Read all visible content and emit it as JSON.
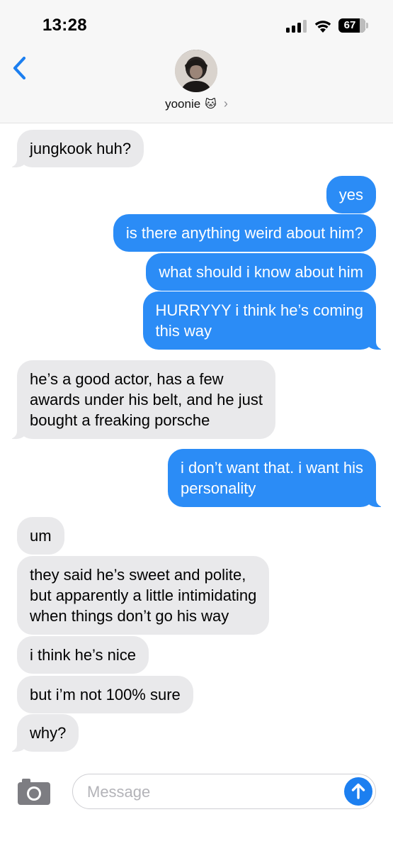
{
  "status_bar": {
    "time": "13:28",
    "battery": "67"
  },
  "header": {
    "contact_name": "yoonie",
    "contact_emoji": "🐱",
    "chevron": "›"
  },
  "messages": [
    {
      "from": "them",
      "text": "jungkook huh?"
    },
    {
      "from": "me",
      "text": "yes"
    },
    {
      "from": "me",
      "text": "is there anything weird about him?"
    },
    {
      "from": "me",
      "text": "what should i know about him"
    },
    {
      "from": "me",
      "text": "HURRYYY i think he’s coming\nthis way"
    },
    {
      "from": "them",
      "text": "he’s a good actor, has a few\nawards under his belt, and he just\nbought a freaking porsche"
    },
    {
      "from": "me",
      "text": "i don’t want that. i want his\npersonality"
    },
    {
      "from": "them",
      "text": "um"
    },
    {
      "from": "them",
      "text": "they said he’s sweet and polite,\nbut apparently a little intimidating\nwhen things don’t go his way"
    },
    {
      "from": "them",
      "text": "i think he’s nice"
    },
    {
      "from": "them",
      "text": "but i’m not 100% sure"
    },
    {
      "from": "them",
      "text": "why?"
    }
  ],
  "composer": {
    "placeholder": "Message",
    "value": ""
  },
  "colors": {
    "incoming_bubble": "#e9e9eb",
    "outgoing_bubble": "#2b8cf6",
    "accent": "#1c7ff0"
  },
  "icons": [
    "back-chevron-icon",
    "cellular-signal-icon",
    "wifi-icon",
    "battery-icon",
    "camera-icon",
    "send-arrow-icon"
  ]
}
